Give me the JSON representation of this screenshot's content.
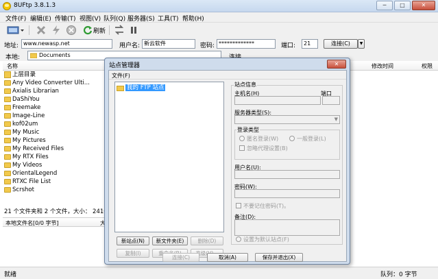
{
  "window": {
    "title": "8UFtp 3.8.1.3",
    "controls": {
      "minimize": "─",
      "maximize": "□",
      "close": "✕"
    }
  },
  "menu": [
    "文件(F)",
    "编辑(E)",
    "传输(T)",
    "视图(V)",
    "队列(Q)",
    "服务器(S)",
    "工具(T)",
    "帮助(H)"
  ],
  "toolbar": {
    "refresh_label": "刷新"
  },
  "connection": {
    "address_label": "地址:",
    "address_value": "www.newasp.net",
    "username_label": "用户名:",
    "username_value": "新云软件",
    "password_label": "密码:",
    "password_value": "*************",
    "port_label": "端口:",
    "port_value": "21",
    "connect_label": "连接(C)"
  },
  "local": {
    "path_label": "本地:",
    "path_value": "Documents",
    "col_name": "名称",
    "col_name2": "本地文件名[0/0 字节]",
    "col_size_short": "大",
    "status_text": "21 个文件夹和 2 个文件，大小： 2410 字",
    "items": [
      {
        "name": "上层目录",
        "type": "up"
      },
      {
        "name": "Any Video Converter Ulti...",
        "type": "folder"
      },
      {
        "name": "Axialis Librarian",
        "type": "folder"
      },
      {
        "name": "DaShiYou",
        "type": "folder"
      },
      {
        "name": "Freemake",
        "type": "folder"
      },
      {
        "name": "Image-Line",
        "type": "folder"
      },
      {
        "name": "kof02um",
        "type": "folder"
      },
      {
        "name": "My Music",
        "type": "folder"
      },
      {
        "name": "My Pictures",
        "type": "folder"
      },
      {
        "name": "My Received Files",
        "type": "folder"
      },
      {
        "name": "My RTX Files",
        "type": "folder"
      },
      {
        "name": "My Videos",
        "type": "folder"
      },
      {
        "name": "OrientalLegend",
        "type": "folder"
      },
      {
        "name": "RTXC File List",
        "type": "folder"
      },
      {
        "name": "Scrshot",
        "type": "folder"
      }
    ]
  },
  "remote": {
    "conn_label_partial": "连接",
    "col_modified": "修改时间",
    "col_permissions": "权限"
  },
  "statusbar": {
    "left": "就绪",
    "queue": "队列：0 字节"
  },
  "dialog": {
    "title": "站点管理器",
    "close": "✕",
    "menu_file": "文件(F)",
    "tree_root": "我的 FTP 站点",
    "site_info": "站点信息",
    "host_label": "主机名(H)",
    "port_label": "端口",
    "server_type_label": "服务器类型(S):",
    "login_type_label": "登录类型",
    "anonymous_label": "匿名登录(W)",
    "normal_label": "一般登录(L)",
    "ignore_proxy_label": "忽略代理设置(B)",
    "username_label": "用户名(U):",
    "password_label": "密码(W):",
    "no_remember_label": "不要记住密码(T)。",
    "note_label": "备注(D):",
    "default_site_label": "设置为默认站点(F)",
    "new_site": "新站点(N)",
    "new_folder": "新文件夹(E)",
    "delete": "删除(D)",
    "copy": "复制(I)",
    "rename": "重命名(R)",
    "advanced": "高级(V)...",
    "connect": "连接(C)",
    "cancel": "取消(A)",
    "save_exit": "保存并退出(X)"
  }
}
